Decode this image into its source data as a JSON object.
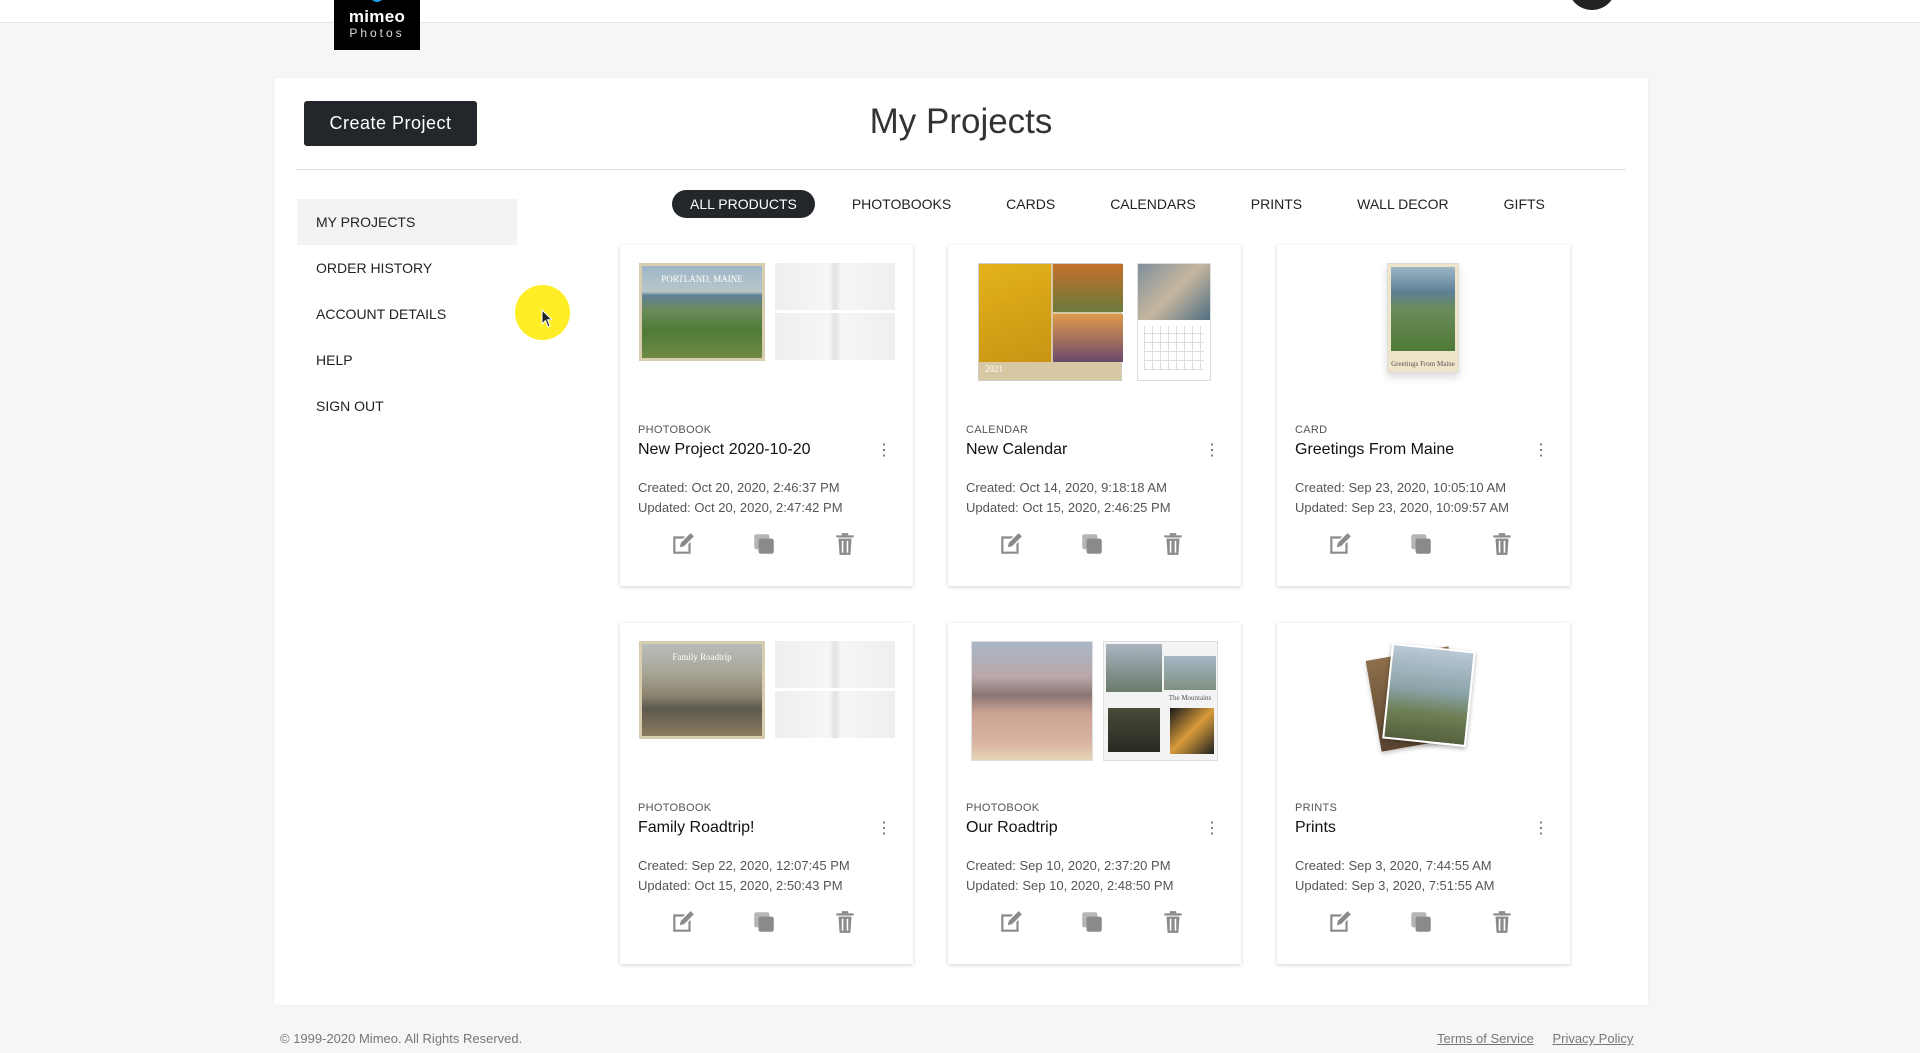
{
  "brand": {
    "name": "mimeo",
    "sub": "Photos"
  },
  "page": {
    "title": "My Projects",
    "create_label": "Create Project"
  },
  "sidebar": {
    "items": [
      {
        "label": "MY PROJECTS",
        "active": true
      },
      {
        "label": "ORDER HISTORY"
      },
      {
        "label": "ACCOUNT DETAILS"
      },
      {
        "label": "HELP"
      },
      {
        "label": "SIGN OUT"
      }
    ]
  },
  "filters": [
    {
      "label": "ALL PRODUCTS",
      "active": true
    },
    {
      "label": "PHOTOBOOKS"
    },
    {
      "label": "CARDS"
    },
    {
      "label": "CALENDARS"
    },
    {
      "label": "PRINTS"
    },
    {
      "label": "WALL DECOR"
    },
    {
      "label": "GIFTS"
    }
  ],
  "projects": [
    {
      "type": "PHOTOBOOK",
      "name": "New Project 2020-10-20",
      "created": "Created: Oct 20, 2020, 2:46:37 PM",
      "updated": "Updated: Oct 20, 2020, 2:47:42 PM",
      "cover_title": "PORTLAND, MAINE"
    },
    {
      "type": "CALENDAR",
      "name": "New Calendar",
      "created": "Created: Oct 14, 2020, 9:18:18 AM",
      "updated": "Updated: Oct 15, 2020, 2:46:25 PM",
      "cover_title": "2021"
    },
    {
      "type": "CARD",
      "name": "Greetings From Maine",
      "created": "Created: Sep 23, 2020, 10:05:10 AM",
      "updated": "Updated: Sep 23, 2020, 10:09:57 AM",
      "cover_title": "Greetings From Maine"
    },
    {
      "type": "PHOTOBOOK",
      "name": "Family Roadtrip!",
      "created": "Created: Sep 22, 2020, 12:07:45 PM",
      "updated": "Updated: Oct 15, 2020, 2:50:43 PM",
      "cover_title": "Family Roadtrip"
    },
    {
      "type": "PHOTOBOOK",
      "name": "Our Roadtrip",
      "created": "Created: Sep 10, 2020, 2:37:20 PM",
      "updated": "Updated: Sep 10, 2020, 2:48:50 PM",
      "cover_title": "The Mountains"
    },
    {
      "type": "PRINTS",
      "name": "Prints",
      "created": "Created: Sep 3, 2020, 7:44:55 AM",
      "updated": "Updated: Sep 3, 2020, 7:51:55 AM"
    }
  ],
  "actions": {
    "edit_icon": "edit-icon",
    "duplicate_icon": "duplicate-icon",
    "delete_icon": "trash-icon"
  },
  "footer": {
    "copyright": "© 1999-2020 Mimeo. All Rights Reserved.",
    "terms": "Terms of Service",
    "privacy": "Privacy Policy"
  },
  "colors": {
    "primary": "#23272b",
    "accent": "#1e9be6",
    "cursor": "#ffeb00"
  }
}
